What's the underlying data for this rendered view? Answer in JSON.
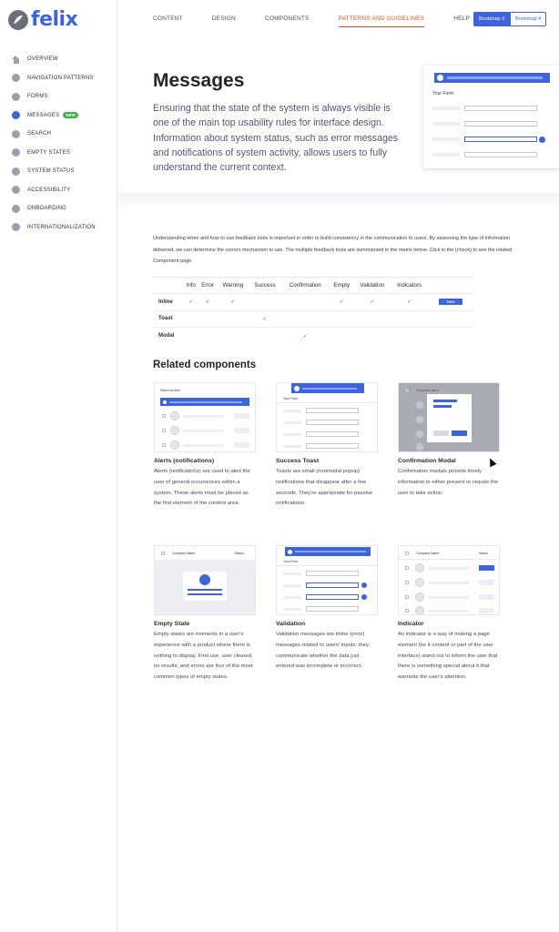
{
  "brand": {
    "name": "felix",
    "accent": "#3d63dd"
  },
  "sidebar": {
    "items": [
      {
        "label": "OVERVIEW",
        "icon": "home-icon"
      },
      {
        "label": "NAVIGATION PATTERNS"
      },
      {
        "label": "FORMS"
      },
      {
        "label": "MESSAGES",
        "badge": "NEW",
        "active": true
      },
      {
        "label": "SEARCH"
      },
      {
        "label": "EMPTY STATES"
      },
      {
        "label": "SYSTEM STATUS"
      },
      {
        "label": "ACCESSIBILITY"
      },
      {
        "label": "ONBOARDING"
      },
      {
        "label": "INTERNATIONALIZATION"
      }
    ]
  },
  "topnav": {
    "links": [
      "CONTENT",
      "DESIGN",
      "COMPONENTS",
      "PATTERNS AND GUIDELINES",
      "HELP"
    ],
    "active_index": 3,
    "bootstrap": [
      "Bootstrap 3",
      "Bootstrap 4"
    ]
  },
  "hero": {
    "title": "Messages",
    "text": "Ensuring that the state of the system is always visible is one of the main top usability rules for interface design. Information about system status, such as error messages and notifications of system activity, allows users to fully understand the current context.",
    "card_label": "Your Form"
  },
  "intro": "Understanding when and how to use feedback tools is important in order to build consistency in the communication to users. By assessing the type of information delivered, we can determine the correct mechanism to use.  The multiple feedback tools are summarised in the matrix below. Click in the (check) to see the related Component page.",
  "matrix": {
    "columns": [
      "Info",
      "Error",
      "Warning",
      "Success",
      "Confirmation",
      "Empty",
      "Validation",
      "Indicators"
    ],
    "rows": [
      {
        "name": "Inline",
        "cells": [
          "✓",
          "✓",
          "✓",
          "",
          "",
          "✓",
          "✓",
          "✓"
        ],
        "extra": "New"
      },
      {
        "name": "Toast",
        "cells": [
          "",
          "",
          "",
          "✓",
          "",
          "",
          "",
          ""
        ],
        "extra": ""
      },
      {
        "name": "Modal",
        "cells": [
          "",
          "",
          "",
          "",
          "✓",
          "",
          "",
          ""
        ],
        "extra": ""
      }
    ]
  },
  "related": {
    "title": "Related components",
    "components": [
      {
        "name": "Alerts (notifications)",
        "desc": "Alerts (notifications) are used to alert the user of general occurrences within a system. These alerts must be placed as the first element of the content area.",
        "thumb_label": "Select an item"
      },
      {
        "name": "Success Toast",
        "desc": "Toasts are small (nonmodal popup) notifications that disappear after a few seconds. They're appropriate for passive notifications.",
        "thumb_label": "Your Form"
      },
      {
        "name": "Confirmation Modal",
        "desc": "Confirmation modals provide timely information to either prevent or require the user to take action.",
        "thumb_label": "Company Name"
      },
      {
        "name": "Empty State",
        "desc": "Empty states are moments in a user's experience with a product where there is nothing to display. First use, user cleared, no results, and errors are four of the most common types of empty states.",
        "thumb_label": "Company Name",
        "thumb_label2": "Status"
      },
      {
        "name": "Validation",
        "desc": "Validation messages are inline (error) messages related to users' inputs: they communicate whether the data just entered was incomplete or incorrect.",
        "thumb_label": "Your Form"
      },
      {
        "name": "Indicator",
        "desc": "An indicator is a way of making a page element (be it content or part of the user interface) stand out to inform the user that there is something special about it that warrants the user's attention.",
        "thumb_label": "Company Name",
        "thumb_label2": "Status"
      }
    ]
  }
}
